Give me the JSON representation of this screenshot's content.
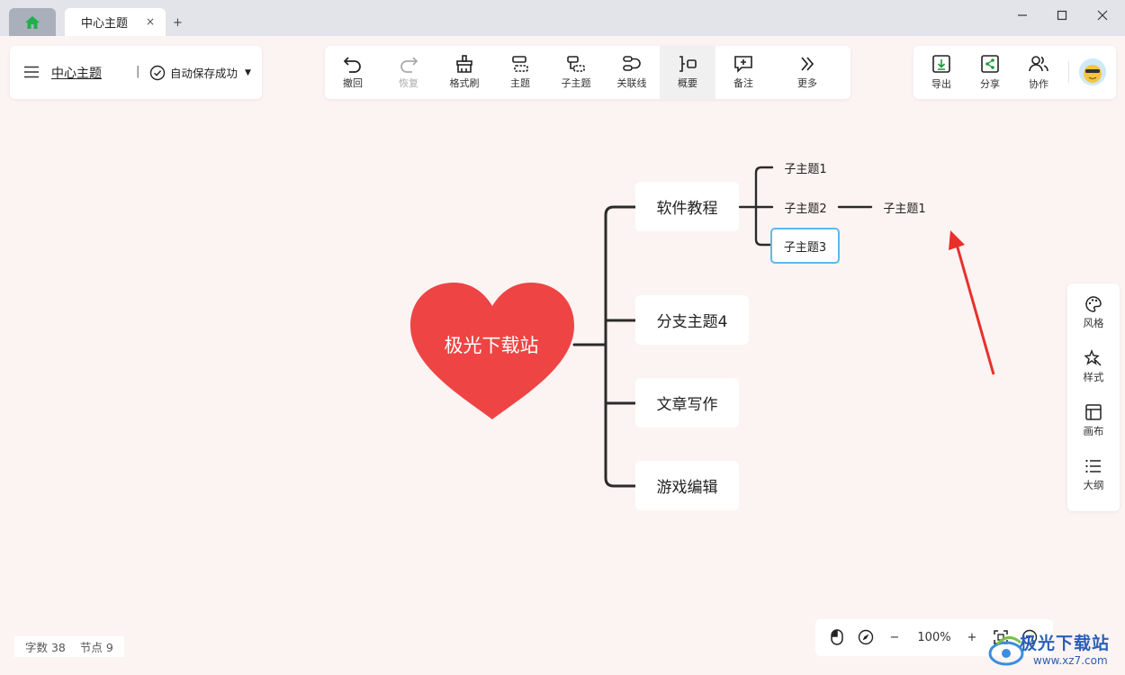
{
  "titlebar": {
    "tab_title": "中心主题",
    "tab_close": "×",
    "new_tab": "+"
  },
  "left_panel": {
    "doc_title": "中心主题",
    "separator": "|",
    "save_status": "自动保存成功"
  },
  "toolbar": {
    "items": [
      {
        "label": "撤回",
        "icon": "undo-icon"
      },
      {
        "label": "恢复",
        "icon": "redo-icon"
      },
      {
        "label": "格式刷",
        "icon": "format-brush-icon"
      },
      {
        "label": "主题",
        "icon": "topic-icon"
      },
      {
        "label": "子主题",
        "icon": "subtopic-icon"
      },
      {
        "label": "关联线",
        "icon": "relation-line-icon"
      },
      {
        "label": "概要",
        "icon": "summary-icon"
      },
      {
        "label": "备注",
        "icon": "note-icon"
      },
      {
        "label": "更多",
        "icon": "more-icon"
      }
    ]
  },
  "right_panel": {
    "export": "导出",
    "share": "分享",
    "collab": "协作"
  },
  "side_panel": {
    "style_theme": "风格",
    "style": "样式",
    "canvas": "画布",
    "outline": "大纲"
  },
  "mindmap": {
    "central": "极光下载站",
    "branches": [
      "软件教程",
      "分支主题4",
      "文章写作",
      "游戏编辑"
    ],
    "sub_topics": [
      "子主题1",
      "子主题2",
      "子主题3"
    ],
    "sub_sub_topic": "子主题1"
  },
  "stats": {
    "word_count": "字数 38",
    "node_count": "节点 9"
  },
  "zoom": {
    "minus": "−",
    "level": "100%",
    "plus": "+"
  },
  "watermark": {
    "text": "极光下载站",
    "url": "www.xz7.com"
  },
  "colors": {
    "heart": "#ef4444",
    "selected_border": "#5db9ea",
    "arrow": "#e8302a",
    "accent_green": "#1a9a3a",
    "canvas_bg": "#fcf4f3"
  }
}
